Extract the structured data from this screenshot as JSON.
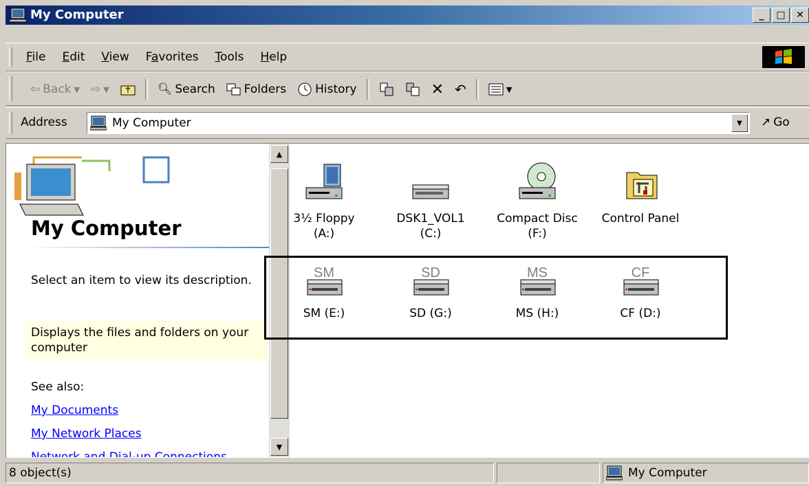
{
  "window": {
    "title": "My Computer"
  },
  "menu": {
    "items": [
      "File",
      "Edit",
      "View",
      "Favorites",
      "Tools",
      "Help"
    ],
    "underline_index": [
      0,
      0,
      0,
      1,
      0,
      0
    ]
  },
  "toolbar": {
    "back_label": "Back",
    "search_label": "Search",
    "folders_label": "Folders",
    "history_label": "History"
  },
  "address": {
    "label": "Address",
    "value": "My Computer",
    "go_label": "Go"
  },
  "left_pane": {
    "title": "My Computer",
    "description": "Select an item to view its description.",
    "info": "Displays the files and folders on your computer",
    "see_also": "See also:",
    "links": [
      "My Documents",
      "My Network Places",
      "Network and Dial-up Connections"
    ]
  },
  "drives": [
    {
      "name": "3½ Floppy",
      "letter": "(A:)",
      "icon": "floppy-drive-icon"
    },
    {
      "name": "DSK1_VOL1",
      "letter": "(C:)",
      "icon": "hard-drive-icon"
    },
    {
      "name": "Compact Disc",
      "letter": "(F:)",
      "icon": "cd-drive-icon"
    },
    {
      "name": "Control Panel",
      "letter": "",
      "icon": "control-panel-icon"
    }
  ],
  "card_drives": [
    {
      "tag": "SM",
      "label": "SM (E:)"
    },
    {
      "tag": "SD",
      "label": "SD (G:)"
    },
    {
      "tag": "MS",
      "label": "MS (H:)"
    },
    {
      "tag": "CF",
      "label": "CF (D:)"
    }
  ],
  "status": {
    "count": "8 object(s)",
    "zone": "My Computer"
  },
  "colors": {
    "title_start": "#0a246a",
    "title_end": "#a6caf0",
    "link": "#0000ff",
    "info_bg": "#ffffe1",
    "chrome": "#d4d0c8"
  }
}
